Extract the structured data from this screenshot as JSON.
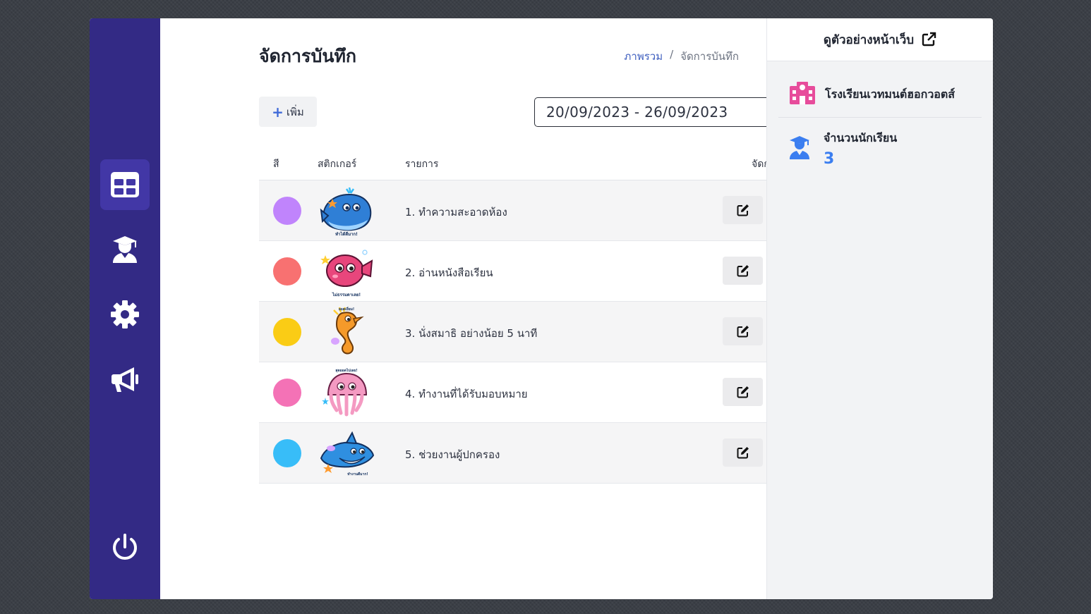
{
  "page": {
    "title": "จัดการบันทึก"
  },
  "breadcrumb": {
    "home": "ภาพรวม",
    "separator": "/",
    "current": "จัดการบันทึก"
  },
  "toolbar": {
    "add_label": "เพิ่ม",
    "add_icon": "plus-icon"
  },
  "date_range": {
    "value": "20/09/2023 - 26/09/2023"
  },
  "table": {
    "headers": {
      "color": "สี",
      "sticker": "สติกเกอร์",
      "item": "รายการ",
      "actions": "จัดการ"
    },
    "rows": [
      {
        "label": "1. ทำความสะอาดห้อง",
        "color": "#c084fc",
        "sticker": "whale-sticker"
      },
      {
        "label": "2. อ่านหนังสือเรียน",
        "color": "#f87171",
        "sticker": "fish-sticker"
      },
      {
        "label": "3. นั่งสมาธิ อย่างน้อย 5 นาที",
        "color": "#facc15",
        "sticker": "seahorse-sticker"
      },
      {
        "label": "4. ทำงานที่ได้รับมอบหมาย",
        "color": "#f472b6",
        "sticker": "jellyfish-sticker"
      },
      {
        "label": "5. ช่วยงานผู้ปกครอง",
        "color": "#38bdf8",
        "sticker": "shark-sticker"
      }
    ]
  },
  "sidebar": {
    "items": [
      {
        "icon": "table-icon",
        "active": true
      },
      {
        "icon": "graduate-icon"
      },
      {
        "icon": "gear-icon"
      },
      {
        "icon": "megaphone-icon"
      }
    ],
    "logout_icon": "power-icon"
  },
  "right_panel": {
    "preview_label": "ดูตัวอย่างหน้าเว็บ",
    "school_name": "โรงเรียนเวทมนต์ฮอกวอตส์",
    "students_label": "จำนวนนักเรียน",
    "students_count": "3"
  },
  "colors": {
    "sidebar": "#332a85",
    "accent": "#3b7ef0",
    "school_icon": "#e74c9b"
  }
}
